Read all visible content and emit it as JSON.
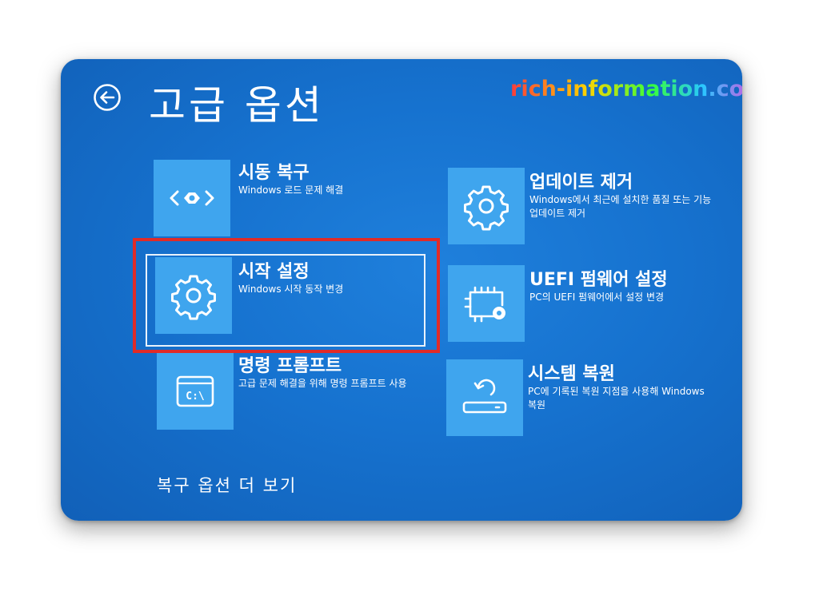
{
  "header": {
    "title": "고급 옵션",
    "back_icon": "back-arrow-circle-icon"
  },
  "watermark": "rich-information.com",
  "options": [
    {
      "title": "시동 복구",
      "desc": "Windows 로드 문제 해결",
      "icon": "startup-repair-icon"
    },
    {
      "title": "시작 설정",
      "desc": "Windows 시작 동작 변경",
      "icon": "gear-icon"
    },
    {
      "title": "명령 프롬프트",
      "desc": "고급 문제 해결을 위해 명령 프롬프트 사용",
      "icon": "command-prompt-icon",
      "icon_text": "C:\\"
    },
    {
      "title": "업데이트 제거",
      "desc": "Windows에서 최근에 설치한 품질 또는 기능 업데이트 제거",
      "icon": "gear-icon"
    },
    {
      "title": "UEFI 펌웨어 설정",
      "desc": "PC의 UEFI 펌웨어에서 설정 변경",
      "icon": "firmware-chip-icon"
    },
    {
      "title": "시스템 복원",
      "desc": "PC에 기록된 복원 지점을 사용해 Windows 복원",
      "icon": "system-restore-icon"
    }
  ],
  "footer": {
    "more_options": "복구 옵션 더 보기"
  },
  "colors": {
    "background": "#1672cf",
    "tile": "#3fa5ee",
    "highlight": "#e02b28",
    "text": "#ffffff"
  }
}
